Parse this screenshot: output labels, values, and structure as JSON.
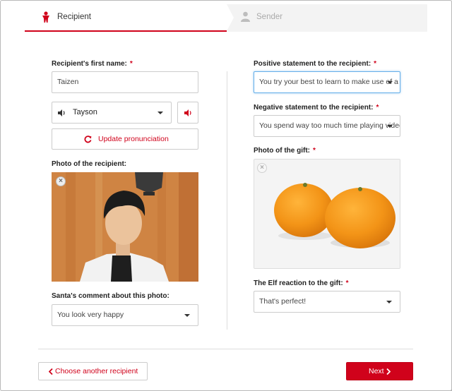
{
  "tabs": {
    "recipient": "Recipient",
    "sender": "Sender"
  },
  "left": {
    "first_name_label": "Recipient's first name:",
    "first_name_value": "Taizen",
    "required_mark": "*",
    "voice_selected": "Tayson",
    "update_pronunciation": "Update pronunciation",
    "photo_label": "Photo of the recipient:",
    "comment_label": "Santa's comment about this photo:",
    "comment_selected": "You look very happy"
  },
  "right": {
    "positive_label": "Positive statement to the recipient:",
    "positive_value": "You try your best to learn to make use of a co",
    "negative_label": "Negative statement to the recipient:",
    "negative_value": "You spend way too much time playing video g",
    "gift_label": "Photo of the gift:",
    "elf_label": "The Elf reaction to the gift:",
    "elf_selected": "That's perfect!"
  },
  "footer": {
    "back_button": "Choose another recipient",
    "next_button": "Next"
  },
  "colors": {
    "accent": "#d0021b",
    "focus_border": "#66afe9"
  },
  "icons": {
    "recipient_tab": "elf-icon",
    "sender_tab": "user-icon",
    "voice": "speaker-icon",
    "play": "speaker-icon",
    "refresh": "refresh-icon",
    "remove": "close-circle-icon",
    "back": "chevron-left-icon",
    "next": "chevron-right-icon"
  }
}
